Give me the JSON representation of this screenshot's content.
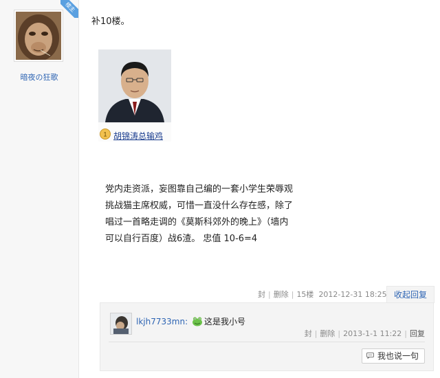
{
  "author": {
    "name": "暗夜の狂歌",
    "badge": "楼主"
  },
  "post": {
    "opening": "补10楼。",
    "quote": {
      "rank": "1",
      "link_text": "胡锦涛总输鸡"
    },
    "body_lines": [
      "党内走资派，妄图靠自己编的一套小学生荣辱观",
      "挑战猫主席权威，可惜一直没什么存在感，除了",
      "唱过一首略走调的《莫斯科郊外的晚上》（墙内",
      "可以自行百度）战6渣。 忠值 10-6=4"
    ],
    "meta": {
      "block": "封",
      "delete": "删除",
      "floor": "15楼",
      "time": "2012-12-31 18:25"
    },
    "reply_toggle": "收起回复"
  },
  "sub_reply": {
    "user": "lkjh7733mn",
    "colon": ":",
    "emoji_icon": "frog-emoticon-icon",
    "content": "这是我小号",
    "meta": {
      "block": "封",
      "delete": "删除",
      "time": "2013-1-1 11:22",
      "reply": "回复"
    }
  },
  "say_button": "我也说一句",
  "colors": {
    "link": "#2d64b3",
    "badge": "#5aa0e0",
    "meta": "#888888"
  }
}
